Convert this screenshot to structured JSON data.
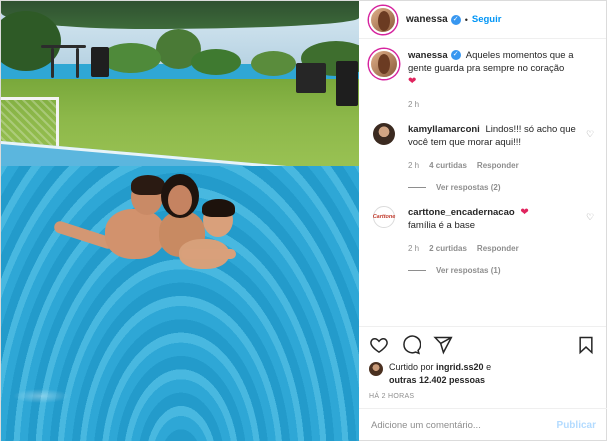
{
  "header": {
    "username": "wanessa",
    "separator": "•",
    "follow_label": "Seguir"
  },
  "caption": {
    "username": "wanessa",
    "text": "Aqueles momentos que a gente guarda pra sempre no coração",
    "emoji": "❤",
    "time": "2 h"
  },
  "comments": [
    {
      "username": "kamyllamarconi",
      "text": "Lindos!!! só acho que você tem que morar aqui!!!",
      "time": "2 h",
      "likes": "4 curtidas",
      "reply_label": "Responder",
      "view_replies": "Ver respostas (2)"
    },
    {
      "username": "carttone_encadernacao",
      "emoji": "❤",
      "text": "família é a base",
      "avatar_text": "Carttone",
      "time": "2 h",
      "likes": "2 curtidas",
      "reply_label": "Responder",
      "view_replies": "Ver respostas (1)"
    }
  ],
  "actions": {
    "icons": [
      "heart-icon",
      "comment-icon",
      "share-icon",
      "bookmark-icon"
    ]
  },
  "likes": {
    "prefix": "Curtido por",
    "user": "ingrid.ss20",
    "connector": "e",
    "others": "outras 12.402 pessoas"
  },
  "posted_ago": "HÁ 2 HORAS",
  "comment_box": {
    "placeholder": "Adicione um comentário...",
    "publish_label": "Publicar"
  },
  "colors": {
    "accent_blue": "#0095f6",
    "publish_disabled": "#b3dbff",
    "muted": "#8e8e8e",
    "heart_red": "#e0245e"
  }
}
